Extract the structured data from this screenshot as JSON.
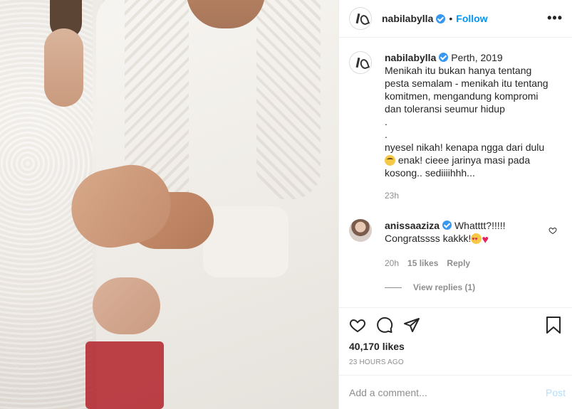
{
  "header": {
    "username": "nabilabylla",
    "follow_label": "Follow",
    "more_label": "•••"
  },
  "caption": {
    "username": "nabilabylla",
    "location": "Perth, 2019",
    "text_part1": "Menikah itu bukan hanya tentang pesta semalam - menikah itu tentang komitmen, mengandung kompromi dan toleransi seumur hidup\n.\n.\nnyesel nikah! kenapa ngga dari dulu",
    "text_part2": " enak! cieee jarinya masi pada kosong.. sediiiihhh...",
    "emoji": "rolling-eyes-emoji",
    "time": "23h"
  },
  "reply": {
    "username": "anissaaziza",
    "text_part1": "Whatttt?!!!!!",
    "text_part2": "Congratssss kakkk!",
    "emojis": [
      "heart-eyes-emoji",
      "red-heart"
    ],
    "time": "20h",
    "likes": "15 likes",
    "reply_label": "Reply",
    "view_replies": "View replies (1)"
  },
  "actions": {
    "likes": "40,170 likes",
    "time_ago": "23 HOURS AGO"
  },
  "add_comment": {
    "placeholder": "Add a comment...",
    "post_label": "Post"
  },
  "colors": {
    "accent": "#0095f6",
    "verified": "#3897f0",
    "muted": "#8e8e8e",
    "post_disabled": "#b2dffc",
    "heart": "#e0245e"
  }
}
